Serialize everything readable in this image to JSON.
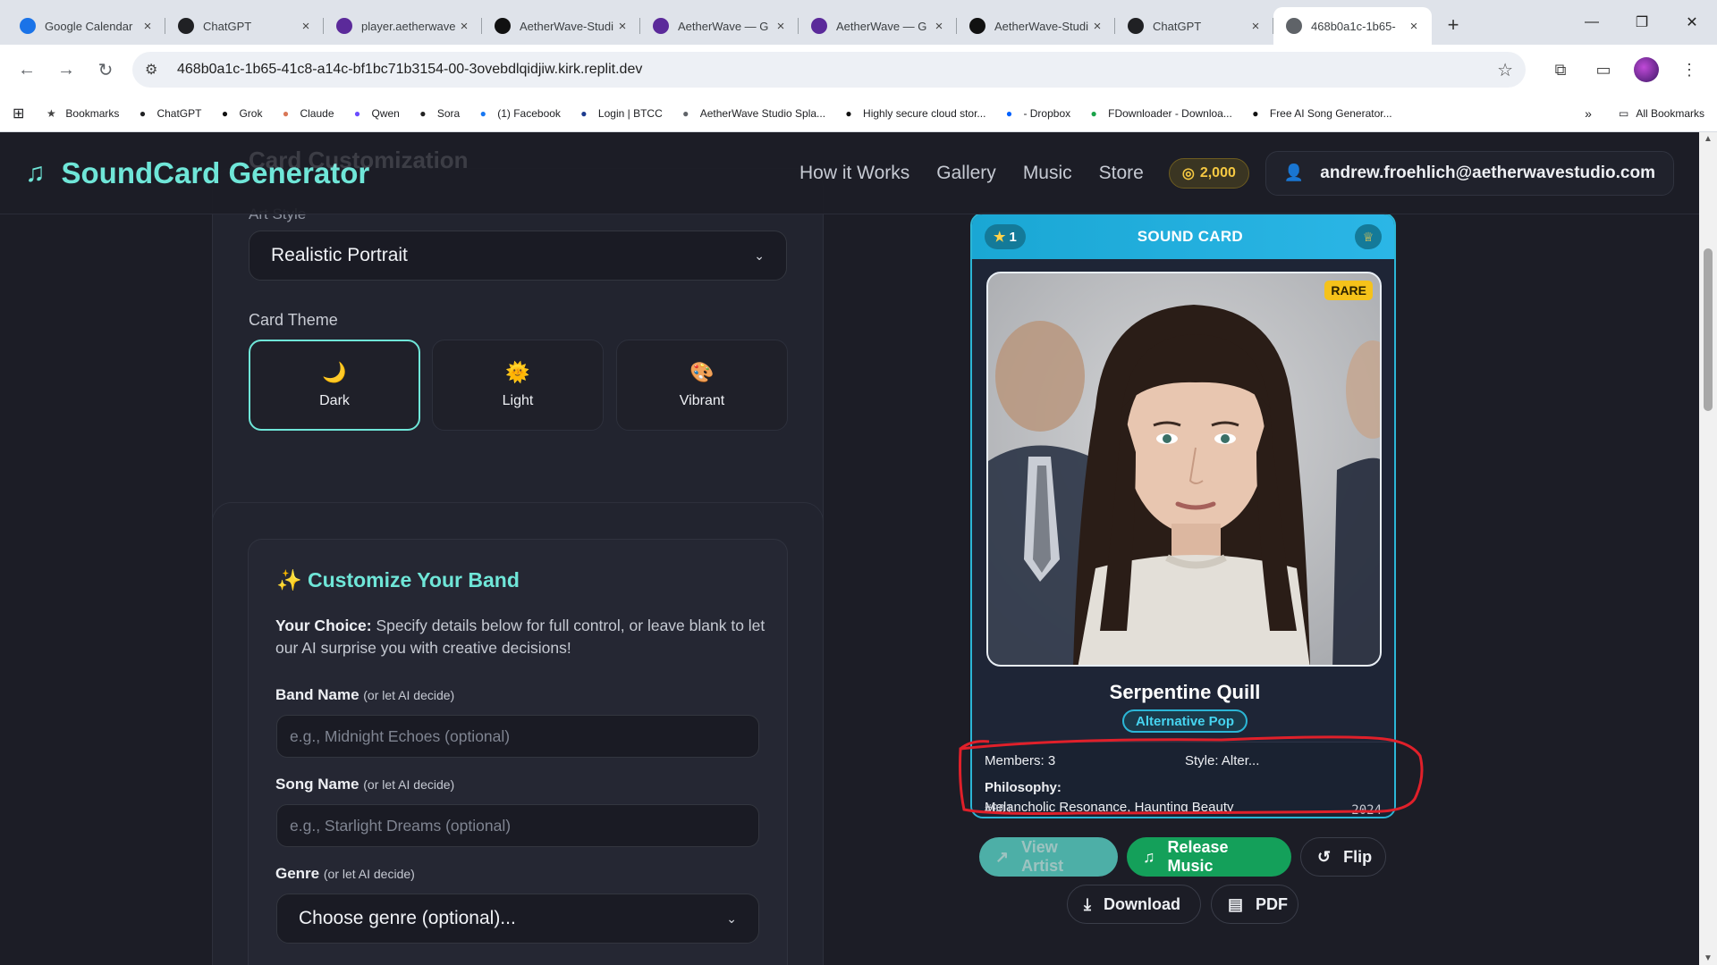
{
  "browser": {
    "tabs": [
      {
        "title": "Google Calendar",
        "icon": "calendar-icon",
        "color": "#1a73e8"
      },
      {
        "title": "ChatGPT",
        "icon": "chatgpt-icon",
        "color": "#202124"
      },
      {
        "title": "player.aetherwave",
        "icon": "aetherwave-icon",
        "color": "#5b2a9a"
      },
      {
        "title": "AetherWave-Studio",
        "icon": "github-icon",
        "color": "#111111"
      },
      {
        "title": "AetherWave — G",
        "icon": "aetherwave-icon",
        "color": "#5b2a9a"
      },
      {
        "title": "AetherWave — G",
        "icon": "aetherwave-icon",
        "color": "#5b2a9a"
      },
      {
        "title": "AetherWave-Studio",
        "icon": "github-icon",
        "color": "#111111"
      },
      {
        "title": "ChatGPT",
        "icon": "chatgpt-icon",
        "color": "#202124"
      },
      {
        "title": "468b0a1c-1b65-",
        "icon": "globe-icon",
        "color": "#5f6368"
      }
    ],
    "url": "468b0a1c-1b65-41c8-a14c-bf1bc71b3154-00-3ovebdlqidjiw.kirk.replit.dev",
    "bookmarks": [
      "Bookmarks",
      "ChatGPT",
      "Grok",
      "Claude",
      "Qwen",
      "Sora",
      "(1) Facebook",
      "Login | BTCC",
      "AetherWave Studio Spla...",
      "Highly secure cloud stor...",
      "- Dropbox",
      "FDownloader - Downloa...",
      "Free AI Song Generator..."
    ],
    "all_bookmarks": "All Bookmarks"
  },
  "header": {
    "logo": "SoundCard Generator",
    "ghost_title": "Card Customization",
    "nav": [
      "How it Works",
      "Gallery",
      "Music",
      "Store"
    ],
    "coins": "2,000",
    "user_email": "andrew.froehlich@aetherwavestudio.com"
  },
  "customization": {
    "art_style_label": "Art Style",
    "art_style_value": "Realistic Portrait",
    "card_theme_label": "Card Theme",
    "themes": [
      {
        "label": "Dark",
        "icon": "moon-icon",
        "glyph": "🌙"
      },
      {
        "label": "Light",
        "icon": "sun-icon",
        "glyph": "🌞"
      },
      {
        "label": "Vibrant",
        "icon": "palette-icon",
        "glyph": "🎨"
      }
    ],
    "selected_theme": "Dark"
  },
  "band": {
    "title": "✨ Customize Your Band",
    "desc_bold": "Your Choice:",
    "desc_rest": " Specify details below for full control, or leave blank to let our AI surprise you with creative decisions!",
    "band_name_label": "Band Name",
    "band_name_sub": "(or let AI decide)",
    "band_name_placeholder": "e.g., Midnight Echoes (optional)",
    "song_name_label": "Song Name",
    "song_name_sub": "(or let AI decide)",
    "song_name_placeholder": "e.g., Starlight Dreams (optional)",
    "genre_label": "Genre",
    "genre_sub": "(or let AI decide)",
    "genre_value": "Choose genre (optional)..."
  },
  "card": {
    "stars": "1",
    "header": "SOUND CARD",
    "rarity": "RARE",
    "artist_name": "Serpentine Quill",
    "genre": "Alternative Pop",
    "members": "Members: 3",
    "style": "Style: Alter...",
    "philosophy_label": "Philosophy:",
    "philosophy": "Melancholic Resonance, Haunting Beauty",
    "card_number": "#001",
    "year": "2024"
  },
  "actions": {
    "view_artist": "View Artist",
    "release_music": "Release Music",
    "flip": "Flip",
    "download": "Download",
    "pdf": "PDF"
  },
  "colors": {
    "accent": "#6fe6d8",
    "card_border": "#2bb6d6",
    "annotation": "#e0202a",
    "coins": "#f5c842"
  }
}
